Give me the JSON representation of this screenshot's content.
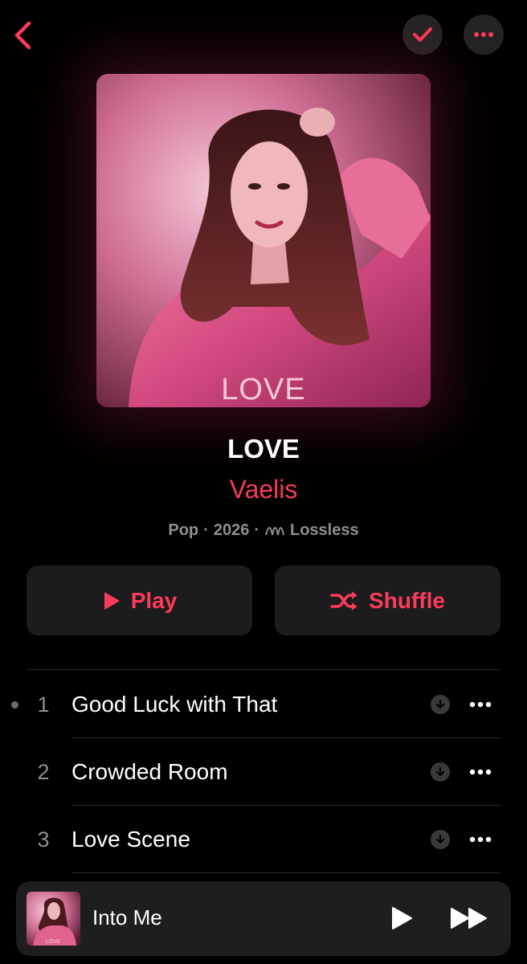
{
  "header": {
    "back_icon": "chevron-left-icon",
    "saved_icon": "checkmark-icon",
    "more_icon": "ellipsis-icon"
  },
  "album": {
    "cover_text": "LOVE",
    "title": "LOVE",
    "artist": "Vaelis",
    "genre": "Pop",
    "year": "2026",
    "quality": "Lossless",
    "quality_icon": "lossless-wave-icon",
    "separator": "·"
  },
  "actions": {
    "play_label": "Play",
    "play_icon": "play-icon",
    "shuffle_label": "Shuffle",
    "shuffle_icon": "shuffle-icon"
  },
  "tracks": [
    {
      "number": "1",
      "title": "Good Luck with That",
      "now_playing": true
    },
    {
      "number": "2",
      "title": "Crowded Room",
      "now_playing": false
    },
    {
      "number": "3",
      "title": "Love Scene",
      "now_playing": false
    }
  ],
  "mini_player": {
    "title": "Into Me",
    "art_text": "LOVE",
    "play_icon": "play-icon",
    "next_icon": "fast-forward-icon"
  },
  "colors": {
    "accent": "#fa3c5a",
    "background": "#000000",
    "button_bg": "#1c1c1e",
    "secondary_text": "#8e8e93"
  }
}
